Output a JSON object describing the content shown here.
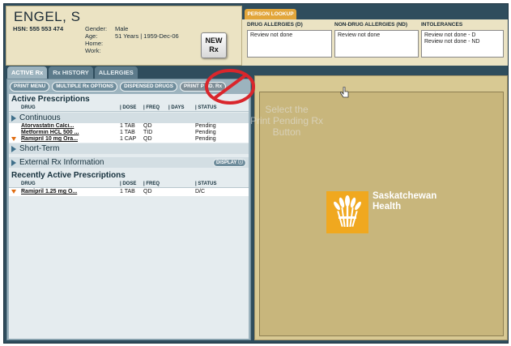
{
  "patient": {
    "name": "ENGEL, S",
    "hsn": "HSN: 555 553 474",
    "gender_label": "Gender:",
    "gender": "Male",
    "age_label": "Age:",
    "age": "51 Years | 1959-Dec-06",
    "home_label": "Home:",
    "home": "",
    "work_label": "Work:",
    "work": ""
  },
  "new_rx": {
    "line1": "NEW",
    "line2": "Rx"
  },
  "person_lookup": "PERSON LOOKUP",
  "allergies": {
    "drug": {
      "header": "DRUG ALLERGIES (D)",
      "lines": [
        "Review not done"
      ]
    },
    "non_drug": {
      "header": "NON-DRUG ALLERGIES (ND)",
      "lines": [
        "Review not done"
      ]
    },
    "intolerances": {
      "header": "INTOLERANCES",
      "lines": [
        "Review not done - D",
        "Review not done - ND"
      ]
    }
  },
  "tabs": [
    {
      "label": "ACTIVE Rx",
      "active": true
    },
    {
      "label": "Rx HISTORY",
      "active": false
    },
    {
      "label": "ALLERGIES",
      "active": false
    }
  ],
  "toolbar": {
    "print_menu": "PRINT MENU",
    "multiple_rx": "MULTIPLE Rx OPTIONS",
    "dispensed": "DISPENSED DRUGS",
    "print_pending": "PRINT P  ND. Rx"
  },
  "active_prescriptions": {
    "title": "Active Prescriptions",
    "columns": {
      "drug": "DRUG",
      "dose": "| DOSE",
      "freq": "| FREQ",
      "days": "| DAYS",
      "status": "| STATUS"
    },
    "continuous": {
      "label": "Continuous",
      "rows": [
        {
          "drug": "Atorvastatin Calci...",
          "dose": "1 TAB",
          "freq": "QD",
          "days": "",
          "status": "Pending",
          "flag": false
        },
        {
          "drug": "Metformin HCL 500 ...",
          "dose": "1 TAB",
          "freq": "TID",
          "days": "",
          "status": "Pending",
          "flag": false
        },
        {
          "drug": "Ramipril 10 mg Ora...",
          "dose": "1 CAP",
          "freq": "QD",
          "days": "",
          "status": "Pending",
          "flag": true
        }
      ]
    },
    "short_term": {
      "label": "Short-Term"
    }
  },
  "external": {
    "label": "External Rx Information",
    "display": "DISPLAY"
  },
  "recent": {
    "title": "Recently Active Prescriptions",
    "columns": {
      "drug": "DRUG",
      "dose": "| DOSE",
      "freq": "| FREQ",
      "status": "| STATUS"
    },
    "rows": [
      {
        "drug": "Ramipril 1.25 mg O...",
        "dose": "1 TAB",
        "freq": "QD",
        "status": "D/C",
        "flag": true
      }
    ]
  },
  "callout": {
    "line1": "Select the",
    "line2": "Print Pending Rx",
    "line3": "Button"
  },
  "logo": {
    "line1": "Saskatchewan",
    "line2": "Health"
  },
  "colors": {
    "accent": "#e2a63b",
    "panel": "#9cb3be",
    "frame": "#2f4d5d",
    "alert": "#d9262c",
    "status_flag": "#e06d12"
  }
}
